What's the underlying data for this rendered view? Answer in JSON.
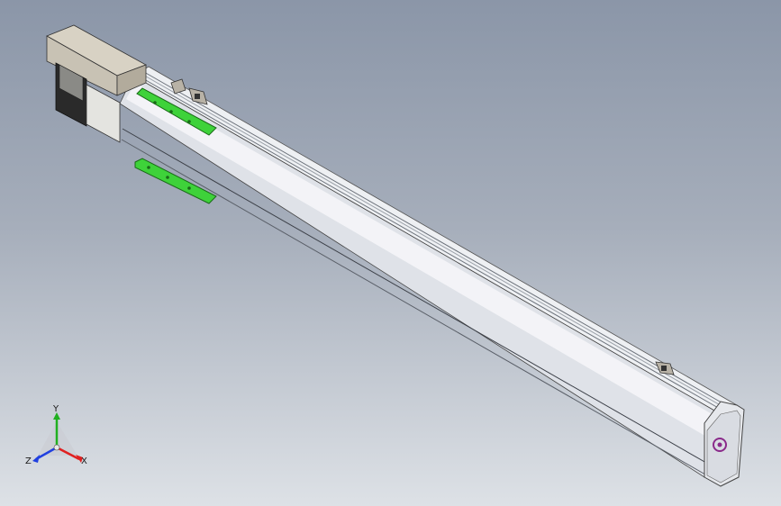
{
  "triad": {
    "x_label": "X",
    "y_label": "Y",
    "z_label": "Z"
  },
  "colors": {
    "background_top": "#8b96a8",
    "background_bottom": "#dde1e6",
    "rail_body": "#dfe2e8",
    "rail_shadow": "#a9aeb8",
    "motor_cover": "#c8c2b4",
    "motor_black": "#222222",
    "bracket_green": "#3ed23a",
    "end_cap_icon": "#8a2a8a",
    "axis_x": "#e02020",
    "axis_y": "#20b020",
    "axis_z": "#2040e0"
  }
}
